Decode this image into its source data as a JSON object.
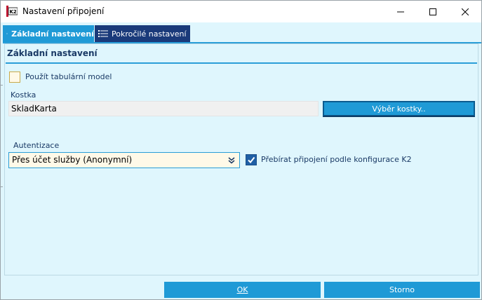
{
  "window": {
    "title": "Nastavení připojení",
    "app_icon": "k2-app-icon",
    "controls": {
      "minimize_icon": "minimize-icon",
      "maximize_icon": "maximize-icon",
      "close_icon": "close-icon"
    }
  },
  "tabs": [
    {
      "label": "Základní nastavení",
      "icon": "list-icon",
      "active": true
    },
    {
      "label": "Pokročilé nastavení",
      "icon": "list-icon",
      "active": false
    }
  ],
  "basic": {
    "section_title": "Základní nastavení",
    "use_tabular_model": {
      "label": "Použít tabulární model",
      "checked": false
    },
    "kostka": {
      "label": "Kostka",
      "value": "SkladKarta",
      "select_button": "Výběr kostky.."
    },
    "authentication": {
      "label": "Autentizace",
      "selected": "Přes účet služby (Anonymní)",
      "dropdown_icon": "double-chevron-down-icon"
    },
    "take_connection": {
      "label": "Přebírat připojení podle konfigurace K2",
      "checked": true
    }
  },
  "footer": {
    "ok_label": "OK",
    "cancel_label": "Storno"
  },
  "colors": {
    "background": "#dff6fd",
    "accent": "#1f9ad6",
    "tab_inactive": "#1a3a7a",
    "input_highlight": "#fff9e8"
  }
}
